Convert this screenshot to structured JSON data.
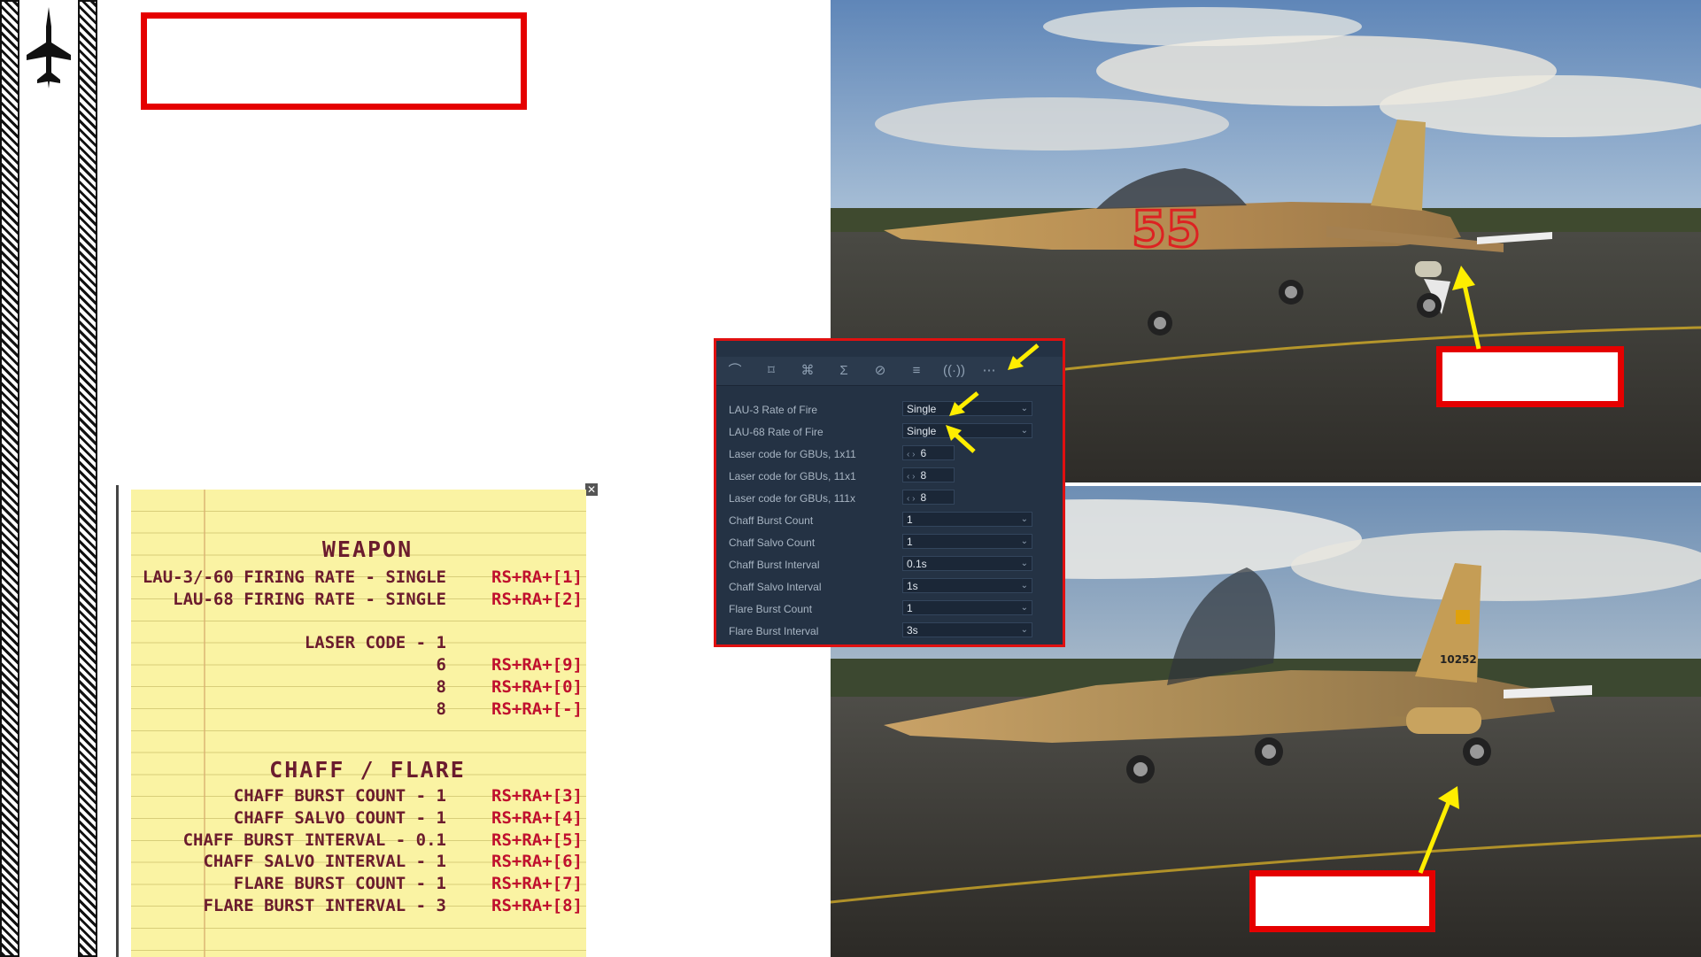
{
  "colors": {
    "callout_red": "#e50000",
    "arrow_yellow": "#ffee00",
    "kneeboard_paper": "#faf3a3",
    "kneeboard_text": "#6b1c2e",
    "kneeboard_key": "#c0102e"
  },
  "sidebar": {
    "logo_icon": "f5-jet-silhouette-icon"
  },
  "kneeboard": {
    "close_glyph": "✕",
    "weapon_title": "WEAPON",
    "weapon_rows": [
      {
        "label": "LAU-3/-60 FIRING RATE - SINGLE",
        "key": "RS+RA+[1]"
      },
      {
        "label": "LAU-68 FIRING RATE - SINGLE",
        "key": "RS+RA+[2]"
      },
      {
        "label": "",
        "key": ""
      },
      {
        "label": "LASER CODE - 1",
        "key": ""
      },
      {
        "label": "6",
        "key": "RS+RA+[9]"
      },
      {
        "label": "8",
        "key": "RS+RA+[0]"
      },
      {
        "label": "8",
        "key": "RS+RA+[-]"
      }
    ],
    "chaff_title": "CHAFF / FLARE",
    "chaff_rows": [
      {
        "label": "CHAFF BURST COUNT - 1",
        "key": "RS+RA+[3]"
      },
      {
        "label": "CHAFF SALVO COUNT - 1",
        "key": "RS+RA+[4]"
      },
      {
        "label": "CHAFF BURST INTERVAL - 0.1",
        "key": "RS+RA+[5]"
      },
      {
        "label": "CHAFF SALVO INTERVAL - 1",
        "key": "RS+RA+[6]"
      },
      {
        "label": "FLARE BURST COUNT - 1",
        "key": "RS+RA+[7]"
      },
      {
        "label": "FLARE BURST INTERVAL - 3",
        "key": "RS+RA+[8]"
      }
    ]
  },
  "aircraft_top": {
    "nose_number": "55"
  },
  "aircraft_bottom": {
    "tail_number": "10252"
  },
  "settings_panel": {
    "toolbar_icons": [
      "route-icon",
      "target-area-icon",
      "command-icon",
      "sum-icon",
      "forbidden-icon",
      "list-arrow-icon",
      "radio-icon",
      "more-icon"
    ],
    "options": [
      {
        "label": "LAU-3 Rate of Fire",
        "value": "Single",
        "kind": "dropdown"
      },
      {
        "label": "LAU-68 Rate of Fire",
        "value": "Single",
        "kind": "dropdown"
      },
      {
        "label": "Laser code for GBUs, 1x11",
        "value": "6",
        "kind": "stepper"
      },
      {
        "label": "Laser code for GBUs, 11x1",
        "value": "8",
        "kind": "stepper"
      },
      {
        "label": "Laser code for GBUs, 111x",
        "value": "8",
        "kind": "stepper"
      },
      {
        "label": "Chaff Burst Count",
        "value": "1",
        "kind": "dropdown"
      },
      {
        "label": "Chaff Salvo Count",
        "value": "1",
        "kind": "dropdown"
      },
      {
        "label": "Chaff Burst Interval",
        "value": "0.1s",
        "kind": "dropdown"
      },
      {
        "label": "Chaff Salvo Interval",
        "value": "1s",
        "kind": "dropdown"
      },
      {
        "label": "Flare Burst Count",
        "value": "1",
        "kind": "dropdown"
      },
      {
        "label": "Flare Burst Interval",
        "value": "3s",
        "kind": "dropdown"
      }
    ]
  }
}
